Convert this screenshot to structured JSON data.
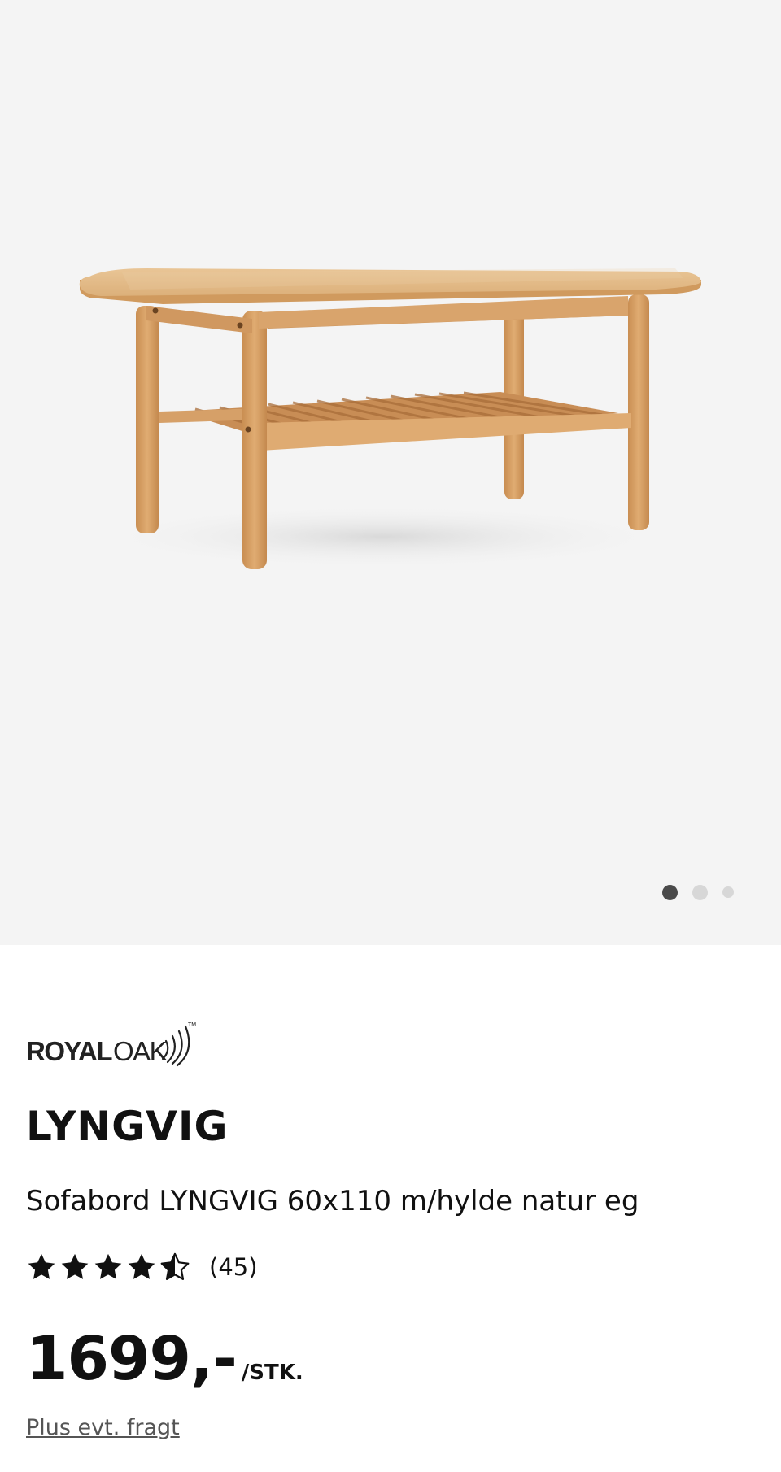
{
  "gallery": {
    "image_alt": "Sofabord LYNGVIG 60x110 m/hylde natur eg",
    "current_index": 1,
    "total_images": 3
  },
  "brand": {
    "name_bold": "ROYAL",
    "name_light": "OAK",
    "trademark": "TM"
  },
  "product": {
    "title": "LYNGVIG",
    "subtitle": "Sofabord LYNGVIG 60x110 m/hylde natur eg"
  },
  "rating": {
    "value": 4.5,
    "max": 5,
    "count_label": "(45)"
  },
  "price": {
    "amount": "1699,-",
    "unit": "/STK."
  },
  "shipping": {
    "label": "Plus evt. fragt"
  },
  "colors": {
    "gallery_background": "#f4f4f4",
    "wood": "#d9a56b",
    "text": "#111111",
    "link": "#555555"
  }
}
